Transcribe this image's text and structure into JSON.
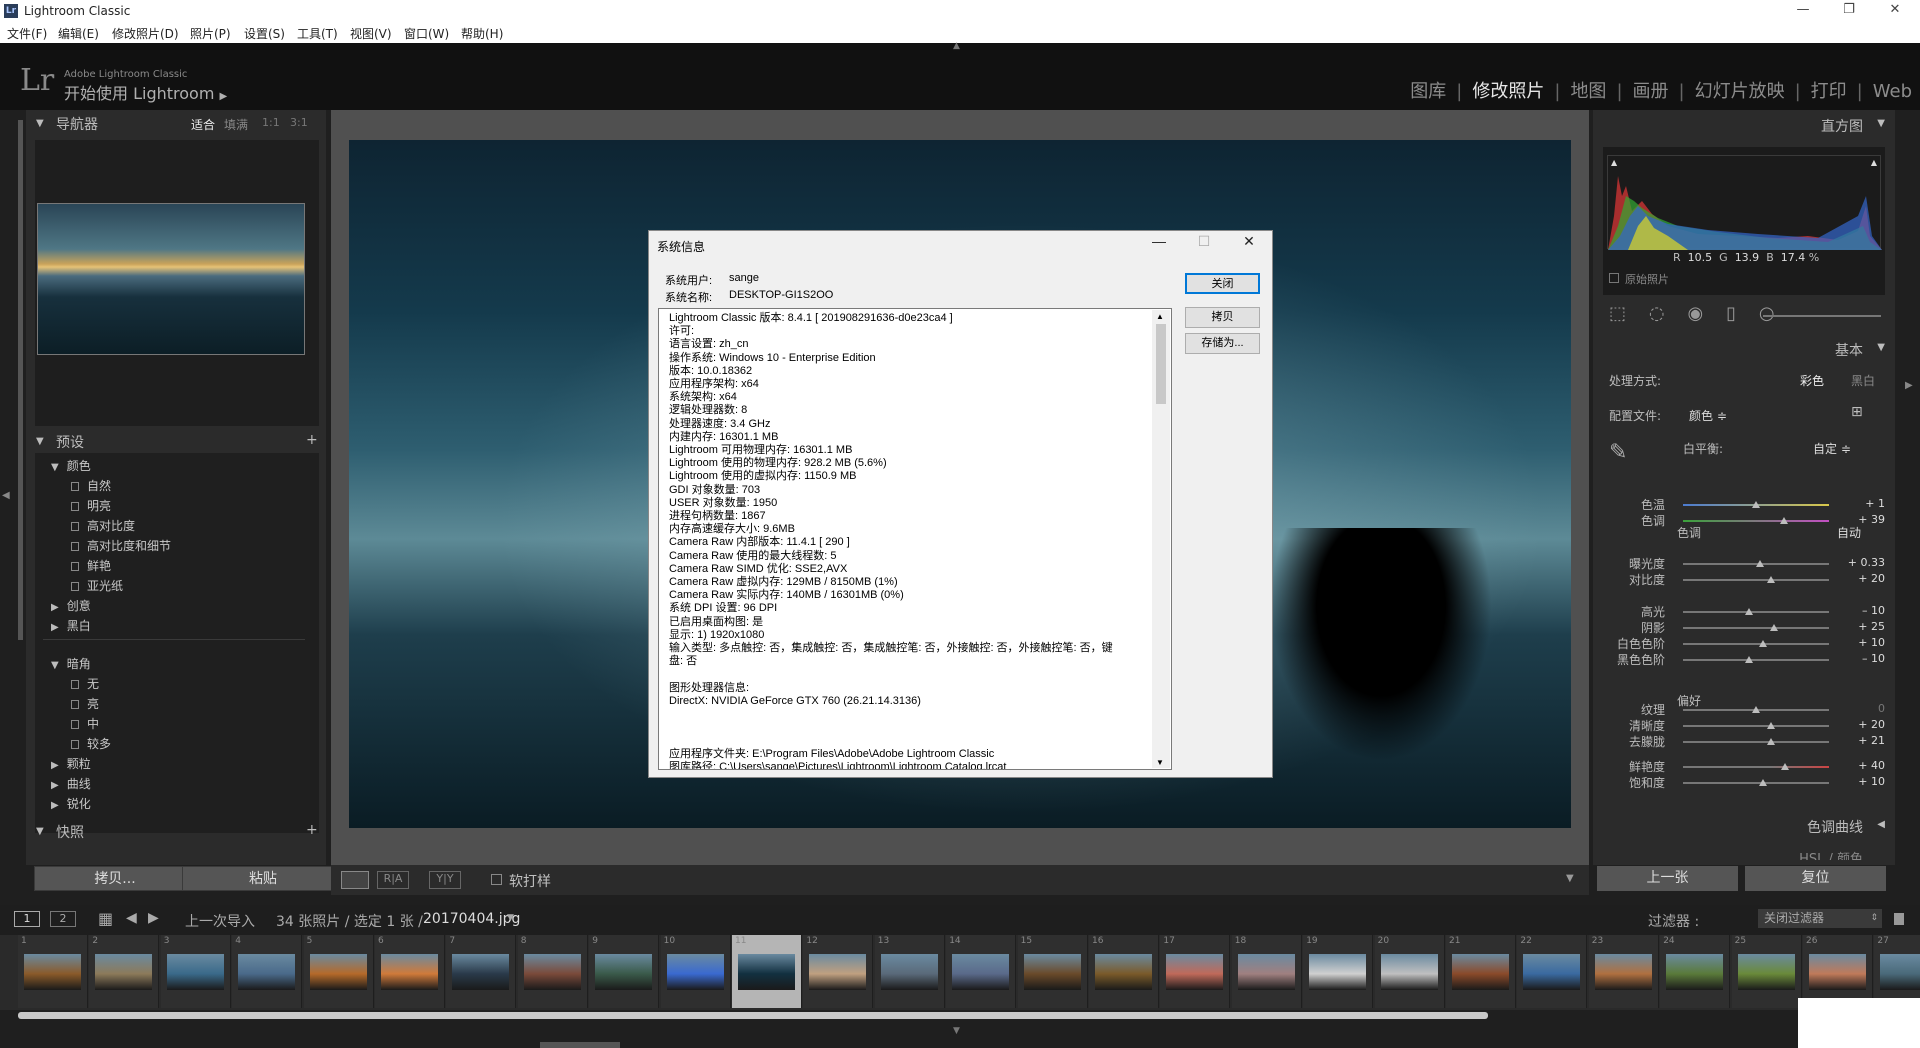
{
  "window": {
    "title": "Lightroom Classic",
    "app_icon": "Lr",
    "min": "—",
    "max": "❐",
    "close": "✕"
  },
  "menu": [
    "文件(F)",
    "编辑(E)",
    "修改照片(D)",
    "照片(P)",
    "设置(S)",
    "工具(T)",
    "视图(V)",
    "窗口(W)",
    "帮助(H)"
  ],
  "identity": {
    "logo": "Lr",
    "brand": "Adobe Lightroom Classic",
    "start": "开始使用 Lightroom"
  },
  "modules": [
    "图库",
    "修改照片",
    "地图",
    "画册",
    "幻灯片放映",
    "打印",
    "Web"
  ],
  "left": {
    "navigator": {
      "title": "导航器",
      "zoom": [
        "适合",
        "填满",
        "1:1",
        "3:1"
      ]
    },
    "presets": {
      "title": "预设",
      "add": "+",
      "groups": [
        {
          "name": "颜色",
          "items": [
            "自然",
            "明亮",
            "高对比度",
            "高对比度和细节",
            "鲜艳",
            "亚光纸"
          ]
        },
        {
          "name": "创意",
          "items": []
        },
        {
          "name": "黑白",
          "items": []
        },
        {
          "name": "暗角",
          "items": [
            "无",
            "亮",
            "中",
            "较多"
          ]
        },
        {
          "name": "颗粒",
          "items": []
        },
        {
          "name": "曲线",
          "items": []
        },
        {
          "name": "锐化",
          "items": []
        }
      ]
    },
    "snapshots": {
      "title": "快照",
      "add": "+"
    },
    "copy_btn": "拷贝...",
    "paste_btn": "粘贴"
  },
  "toolbar": {
    "soft_proof": "软打样"
  },
  "dialog": {
    "title": "系统信息",
    "user_label": "系统用户:",
    "user": "sange",
    "host_label": "系统名称:",
    "host": "DESKTOP-GI1S2OO",
    "lines": [
      "Lightroom Classic 版本: 8.4.1 [ 201908291636-d0e23ca4 ]",
      "许可:",
      "语言设置: zh_cn",
      "操作系统: Windows 10 - Enterprise Edition",
      "版本: 10.0.18362",
      "应用程序架构: x64",
      "系统架构: x64",
      "逻辑处理器数: 8",
      "处理器速度: 3.4 GHz",
      "内建内存: 16301.1 MB",
      "Lightroom 可用物理内存: 16301.1 MB",
      "Lightroom 使用的物理内存: 928.2 MB (5.6%)",
      "Lightroom 使用的虚拟内存: 1150.9 MB",
      "GDI 对象数量: 703",
      "USER 对象数量: 1950",
      "进程句柄数量: 1867",
      "内存高速缓存大小: 9.6MB",
      "Camera Raw 内部版本: 11.4.1 [ 290 ]",
      "Camera Raw 使用的最大线程数: 5",
      "Camera Raw SIMD 优化: SSE2,AVX",
      "Camera Raw 虚拟内存: 129MB / 8150MB (1%)",
      "Camera Raw 实际内存: 140MB / 16301MB (0%)",
      "系统 DPI 设置: 96 DPI",
      "已启用桌面构图: 是",
      "显示: 1) 1920x1080",
      "输入类型: 多点触控: 否，集成触控: 否，集成触控笔: 否，外接触控: 否，外接触控笔: 否，键",
      "盘: 否",
      "",
      "图形处理器信息:",
      "DirectX: NVIDIA GeForce GTX 760 (26.21.14.3136)",
      "",
      "",
      "",
      "应用程序文件夹: E:\\Program Files\\Adobe\\Adobe Lightroom Classic",
      "图库路径: C:\\Users\\sange\\Pictures\\Lightroom\\Lightroom Catalog.lrcat"
    ],
    "btn_close": "关闭",
    "btn_copy": "拷贝",
    "btn_save": "存储为..."
  },
  "right": {
    "histogram": {
      "title": "直方图",
      "r_label": "R",
      "r": "10.5",
      "g_label": "G",
      "g": "13.9",
      "b_label": "B",
      "b": "17.4",
      "pct": "%",
      "original": "原始照片"
    },
    "basic": {
      "title": "基本",
      "treatment_label": "处理方式:",
      "color": "彩色",
      "bw": "黑白",
      "profile_label": "配置文件:",
      "profile": "颜色 ≑",
      "wb_label": "白平衡:",
      "wb": "自定 ≑",
      "tone_label": "色调",
      "auto": "自动",
      "presence_label": "偏好",
      "sliders": [
        {
          "label": "色温",
          "value": "+ 1",
          "pos": 0.5
        },
        {
          "label": "色调",
          "value": "+ 39",
          "pos": 0.69
        },
        {
          "label": "曝光度",
          "value": "+ 0.33",
          "pos": 0.53
        },
        {
          "label": "对比度",
          "value": "+ 20",
          "pos": 0.6
        },
        {
          "label": "高光",
          "value": "– 10",
          "pos": 0.45
        },
        {
          "label": "阴影",
          "value": "+ 25",
          "pos": 0.62
        },
        {
          "label": "白色色阶",
          "value": "+ 10",
          "pos": 0.55
        },
        {
          "label": "黑色色阶",
          "value": "– 10",
          "pos": 0.45
        },
        {
          "label": "纹理",
          "value": "0",
          "pos": 0.5
        },
        {
          "label": "清晰度",
          "value": "+ 20",
          "pos": 0.6
        },
        {
          "label": "去朦胧",
          "value": "+ 21",
          "pos": 0.6
        },
        {
          "label": "鲜艳度",
          "value": "+ 40",
          "pos": 0.7
        },
        {
          "label": "饱和度",
          "value": "+ 10",
          "pos": 0.55
        }
      ]
    },
    "tone_curve": "色调曲线",
    "hsl": "HSL / 颜色",
    "prev_btn": "上一张",
    "reset_btn": "复位"
  },
  "filmstrip": {
    "view1": "1",
    "view2": "2",
    "source": "上一次导入",
    "count": "34 张照片 / 选定 1 张 /",
    "file": "20170404.jpg",
    "filter_label": "过滤器 :",
    "filter": "关闭过滤器",
    "frames": [
      "1",
      "2",
      "3",
      "4",
      "5",
      "6",
      "7",
      "8",
      "9",
      "10",
      "11",
      "12",
      "13",
      "14",
      "15",
      "16",
      "17",
      "18",
      "19",
      "20",
      "21",
      "22",
      "23",
      "24",
      "25",
      "26",
      "27"
    ],
    "selected": "11"
  },
  "colors": {
    "accent": "#e6e6e6",
    "panel": "#2b2b2b",
    "bg": "#1f1f1f"
  }
}
